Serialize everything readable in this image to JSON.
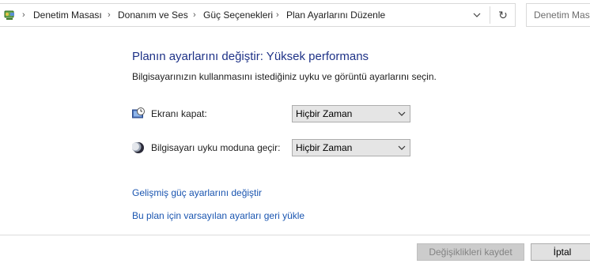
{
  "address_bar": {
    "app_icon": "control-panel-icon",
    "crumbs": [
      "Denetim Masası",
      "Donanım ve Ses",
      "Güç Seçenekleri",
      "Plan Ayarlarını Düzenle"
    ]
  },
  "search": {
    "placeholder": "Denetim Masası"
  },
  "main": {
    "title": "Planın ayarlarını değiştir: Yüksek performans",
    "subtitle": "Bilgisayarınızın kullanmasını istediğiniz uyku ve görüntü ayarlarını seçin.",
    "display_off": {
      "icon": "monitor-clock-icon",
      "label": "Ekranı kapat:",
      "value": "Hiçbir Zaman"
    },
    "sleep": {
      "icon": "moon-icon",
      "label": "Bilgisayarı uyku moduna geçir:",
      "value": "Hiçbir Zaman"
    },
    "links": {
      "advanced": "Gelişmiş güç ayarlarını değiştir",
      "restore": "Bu plan için varsayılan ayarları geri yükle"
    }
  },
  "footer": {
    "save_label": "Değişiklikleri kaydet",
    "cancel_label": "İptal"
  },
  "colors": {
    "title": "#1e3287",
    "link": "#1a55b0"
  }
}
